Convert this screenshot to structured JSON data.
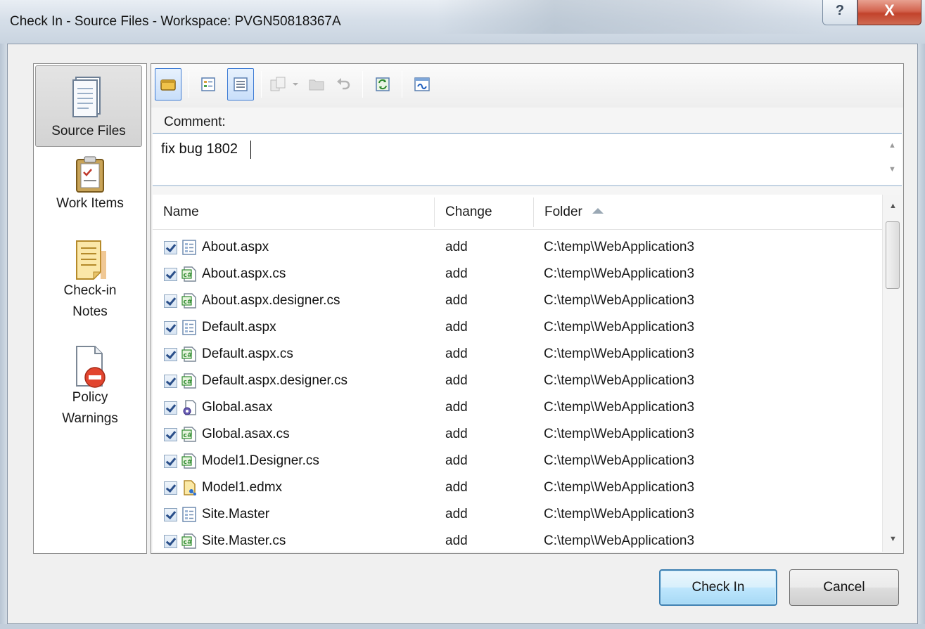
{
  "window": {
    "title": "Check In - Source Files - Workspace: PVGN50818367A",
    "help_glyph": "?",
    "close_glyph": "X"
  },
  "channels": [
    {
      "label": "Source Files",
      "icon": "source-files-icon",
      "selected": true
    },
    {
      "label": "Work Items",
      "icon": "work-items-icon",
      "selected": false
    },
    {
      "label_line1": "Check-in",
      "label_line2": "Notes",
      "icon": "check-in-notes-icon",
      "selected": false
    },
    {
      "label_line1": "Policy",
      "label_line2": "Warnings",
      "icon": "policy-warnings-icon",
      "selected": false
    }
  ],
  "toolbar": {
    "buttons": [
      "shelve-icon",
      "flat-view-icon",
      "tree-view-icon",
      "compare-icon",
      "compare-dropdown-icon",
      "open-folder-icon",
      "undo-icon",
      "refresh-icon",
      "associate-icon"
    ]
  },
  "comment": {
    "label": "Comment:",
    "value": "fix bug 1802"
  },
  "file_list": {
    "columns": {
      "name": "Name",
      "change": "Change",
      "folder": "Folder"
    },
    "sorted_by": "Folder",
    "rows": [
      {
        "name": "About.aspx",
        "change": "add",
        "folder": "C:\\temp\\WebApplication3",
        "icon": "aspx-file-icon",
        "checked": true
      },
      {
        "name": "About.aspx.cs",
        "change": "add",
        "folder": "C:\\temp\\WebApplication3",
        "icon": "csharp-file-icon",
        "checked": true
      },
      {
        "name": "About.aspx.designer.cs",
        "change": "add",
        "folder": "C:\\temp\\WebApplication3",
        "icon": "csharp-file-icon",
        "checked": true
      },
      {
        "name": "Default.aspx",
        "change": "add",
        "folder": "C:\\temp\\WebApplication3",
        "icon": "aspx-file-icon",
        "checked": true
      },
      {
        "name": "Default.aspx.cs",
        "change": "add",
        "folder": "C:\\temp\\WebApplication3",
        "icon": "csharp-file-icon",
        "checked": true
      },
      {
        "name": "Default.aspx.designer.cs",
        "change": "add",
        "folder": "C:\\temp\\WebApplication3",
        "icon": "csharp-file-icon",
        "checked": true
      },
      {
        "name": "Global.asax",
        "change": "add",
        "folder": "C:\\temp\\WebApplication3",
        "icon": "asax-file-icon",
        "checked": true
      },
      {
        "name": "Global.asax.cs",
        "change": "add",
        "folder": "C:\\temp\\WebApplication3",
        "icon": "csharp-file-icon",
        "checked": true
      },
      {
        "name": "Model1.Designer.cs",
        "change": "add",
        "folder": "C:\\temp\\WebApplication3",
        "icon": "csharp-file-icon",
        "checked": true
      },
      {
        "name": "Model1.edmx",
        "change": "add",
        "folder": "C:\\temp\\WebApplication3",
        "icon": "edmx-file-icon",
        "checked": true
      },
      {
        "name": "Site.Master",
        "change": "add",
        "folder": "C:\\temp\\WebApplication3",
        "icon": "aspx-file-icon",
        "checked": true
      },
      {
        "name": "Site.Master.cs",
        "change": "add",
        "folder": "C:\\temp\\WebApplication3",
        "icon": "csharp-file-icon",
        "checked": true
      }
    ]
  },
  "buttons": {
    "check_in": "Check In",
    "cancel": "Cancel"
  },
  "colors": {
    "accent": "#3c7fb1",
    "close_button": "#c2432c",
    "selected_channel": "#d3d3d3"
  }
}
